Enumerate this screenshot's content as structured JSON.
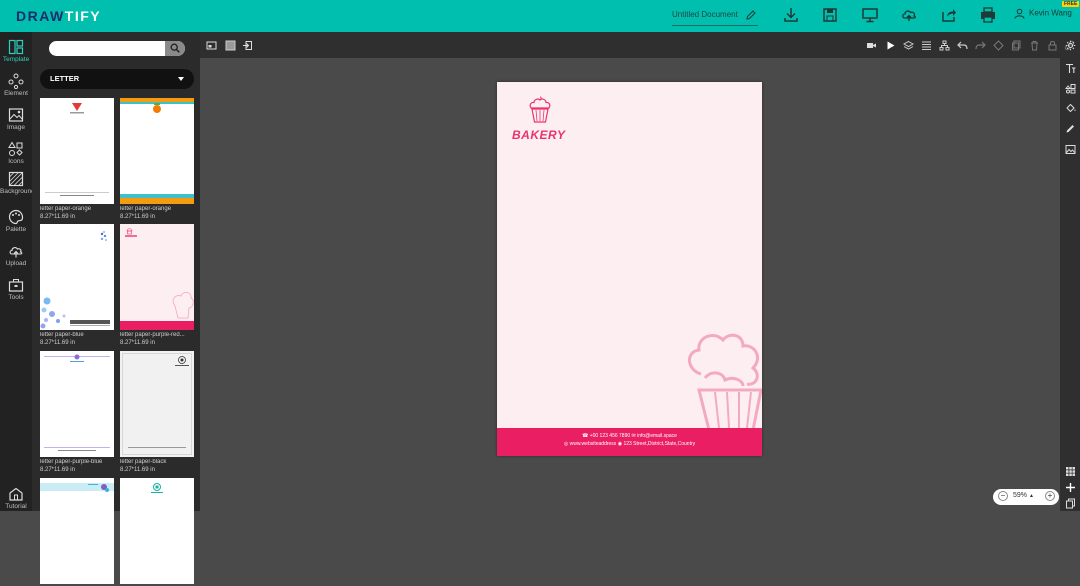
{
  "app": {
    "logo_part1": "DRAW",
    "logo_part2": "TIFY",
    "document_title": "Untitled Document",
    "user_name": "Kevin Wang",
    "plan_badge": "FREE"
  },
  "colors": {
    "topbar": "#00bfae",
    "accent": "#2ecfbf",
    "brand_pink": "#e91e63"
  },
  "leftnav": [
    {
      "label": "Template",
      "icon": "template-icon"
    },
    {
      "label": "Element",
      "icon": "element-icon"
    },
    {
      "label": "Image",
      "icon": "image-icon"
    },
    {
      "label": "Icons",
      "icon": "shapes-icon"
    },
    {
      "label": "Background",
      "icon": "background-icon"
    },
    {
      "label": "Palette",
      "icon": "palette-icon"
    },
    {
      "label": "Upload",
      "icon": "upload-icon"
    },
    {
      "label": "Tools",
      "icon": "toolbox-icon"
    },
    {
      "label": "Tutorial",
      "icon": "tutorial-icon"
    }
  ],
  "panel": {
    "search_placeholder": "",
    "category": "LETTER",
    "templates": [
      {
        "name": "letter paper-orange",
        "size": "8.27*11.69 in"
      },
      {
        "name": "letter paper-orange",
        "size": "8.27*11.69 in"
      },
      {
        "name": "letter paper-blue",
        "size": "8.27*11.69 in"
      },
      {
        "name": "letter paper-purple-red...",
        "size": "8.27*11.69 in"
      },
      {
        "name": "letter paper-purple-blue",
        "size": "8.27*11.69 in"
      },
      {
        "name": "letter paper-black",
        "size": "8.27*11.69 in"
      },
      {
        "name": "",
        "size": ""
      },
      {
        "name": "",
        "size": ""
      }
    ]
  },
  "canvas": {
    "brand_text": "BAKERY",
    "footer_line1": "☎ +00 123 456 7890  ✉ info@email.space",
    "footer_line2": "◎ www.websiteaddress  ◉ 123 Street,District,State,Country"
  },
  "zoom": {
    "value": "59%",
    "minus": "−",
    "plus": "+"
  }
}
